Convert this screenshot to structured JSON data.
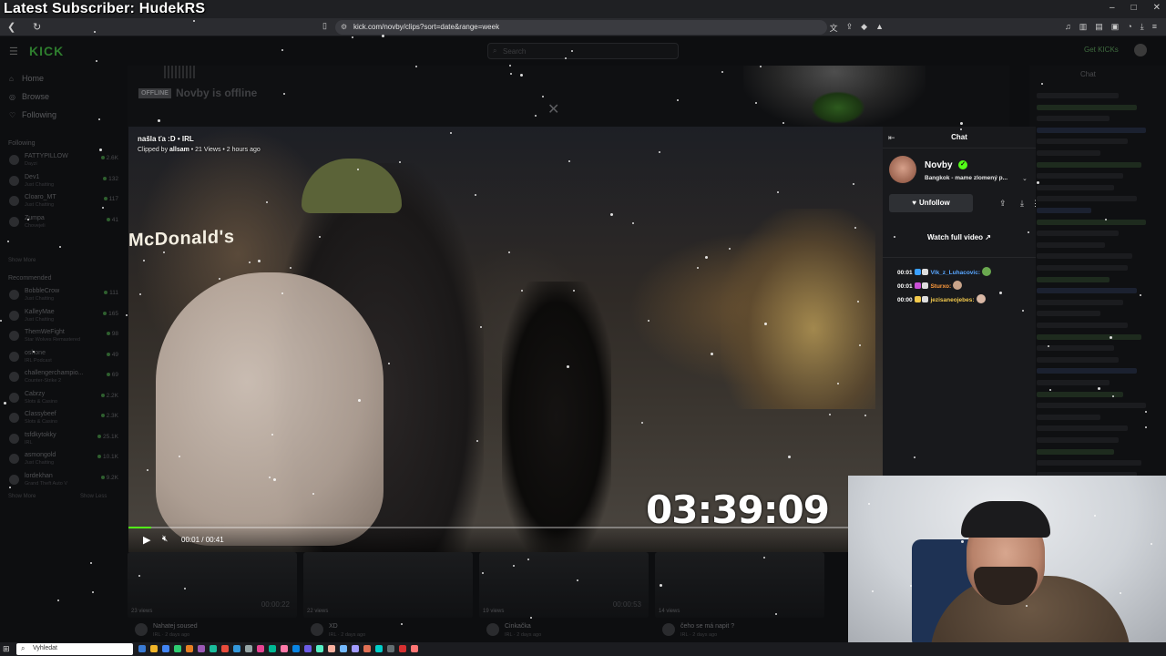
{
  "overlay": {
    "title": "Latest Subscriber: HudekRS"
  },
  "browser": {
    "url": "kick.com/novby/clips?sort=date&range=week",
    "lock_icon": "tune-icon",
    "window_controls": [
      "–",
      "□",
      "✕"
    ]
  },
  "kick": {
    "logo": "KICK",
    "search_placeholder": "Search",
    "get_kick": "Get KICKs",
    "nav": [
      {
        "label": "Home",
        "icon": "home-icon"
      },
      {
        "label": "Browse",
        "icon": "browse-icon"
      },
      {
        "label": "Following",
        "icon": "heart-icon"
      }
    ],
    "following_heading": "Following",
    "following": [
      {
        "name": "FATTYPILLOW",
        "cat": "Dayzi",
        "count": "2.6K"
      },
      {
        "name": "Dev1",
        "cat": "Just Chatting",
        "count": "132"
      },
      {
        "name": "Cloaro_MT",
        "cat": "Just Chatting",
        "count": "117"
      },
      {
        "name": "Zumpa",
        "cat": "Chovejeli",
        "count": "41"
      }
    ],
    "show_more": "Show More",
    "recommended_heading": "Recommended",
    "recommended": [
      {
        "name": "BobbleCrow",
        "cat": "Just Chatting",
        "count": "111"
      },
      {
        "name": "KalleyMae",
        "cat": "Just Chatting",
        "count": "165"
      },
      {
        "name": "ThemWeFight",
        "cat": "Star Wolves Remastered",
        "count": "98"
      },
      {
        "name": "oshone",
        "cat": "IRL Podcast",
        "count": "49"
      },
      {
        "name": "challengerchampio...",
        "cat": "Counter-Strike 2",
        "count": "69"
      },
      {
        "name": "Cabrzy",
        "cat": "Slots & Casino",
        "count": "2.2K"
      },
      {
        "name": "Classybeef",
        "cat": "Slots & Casino",
        "count": "2.3K"
      },
      {
        "name": "tsfdkytokky",
        "cat": "IRL",
        "count": "25.1K"
      },
      {
        "name": "asmongold",
        "cat": "Just Chatting",
        "count": "10.1K"
      },
      {
        "name": "lordekhan",
        "cat": "Grand Theft Auto V",
        "count": "9.2K"
      }
    ],
    "show_more_2": "Show More",
    "show_less": "Show Less",
    "offline_badge": "OFFLINE",
    "offline_text": "Novby is offline",
    "chat_title": "Chat",
    "thumbs": [
      {
        "title": "Nahatej soused",
        "sub": "IRL · 2 days ago",
        "views": "23 views",
        "time": "00:00:22"
      },
      {
        "title": "XD",
        "sub": "IRL · 2 days ago",
        "views": "22 views",
        "time": ""
      },
      {
        "title": "Cinkačka",
        "sub": "IRL · 2 days ago",
        "views": "19 views",
        "time": "00:00:53"
      },
      {
        "title": "čeho se má napit ?",
        "sub": "IRL · 2 days ago",
        "views": "14 views",
        "time": ""
      }
    ]
  },
  "clip": {
    "title": "našla ťa :D • IRL",
    "clipped_by_prefix": "Clipped by ",
    "clipped_by": "allsam",
    "meta_suffix": " • 21 Views • 2 hours ago",
    "sign": "McDonald's",
    "timer": "03:39:09",
    "time": "00:01 / 00:41",
    "progress": 0.03
  },
  "clip_chat": {
    "title": "Chat",
    "streamer": "Novby",
    "stream_title": "Bangkok - mame zlomený p...",
    "unfollow": "Unfollow",
    "watch_full": "Watch full video",
    "messages": [
      {
        "time": "00:01",
        "user": "Vlk_z_Luhacovic:",
        "color": "#58a6ff",
        "badge": "#3aa0ff",
        "emote": "#6aa84f"
      },
      {
        "time": "00:01",
        "user": "Sturxo:",
        "color": "#ff9a3c",
        "badge": "#c94fd6",
        "emote": "#c9a48a"
      },
      {
        "time": "00:00",
        "user": "jezisaneojebes:",
        "color": "#f2c94c",
        "badge": "#f2c94c",
        "emote": "#d9b8a5"
      }
    ]
  },
  "taskbar": {
    "search_placeholder": "Vyhledat"
  },
  "colors": {
    "kick_green": "#53fc18"
  }
}
